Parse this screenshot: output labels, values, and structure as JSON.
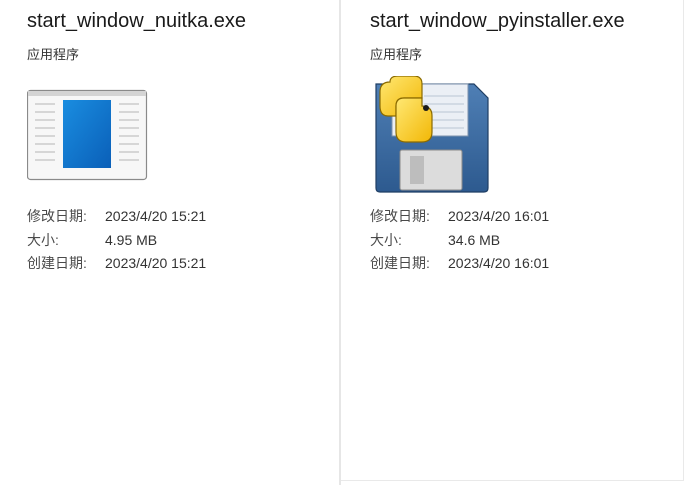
{
  "files": [
    {
      "name": "start_window_nuitka.exe",
      "type": "应用程序",
      "icon": "window-app-icon",
      "properties": [
        {
          "label": "修改日期:",
          "value": "2023/4/20 15:21"
        },
        {
          "label": "大小:",
          "value": "4.95 MB"
        },
        {
          "label": "创建日期:",
          "value": "2023/4/20 15:21"
        }
      ]
    },
    {
      "name": "start_window_pyinstaller.exe",
      "type": "应用程序",
      "icon": "python-floppy-icon",
      "properties": [
        {
          "label": "修改日期:",
          "value": "2023/4/20 16:01"
        },
        {
          "label": "大小:",
          "value": "34.6 MB"
        },
        {
          "label": "创建日期:",
          "value": "2023/4/20 16:01"
        }
      ]
    }
  ]
}
